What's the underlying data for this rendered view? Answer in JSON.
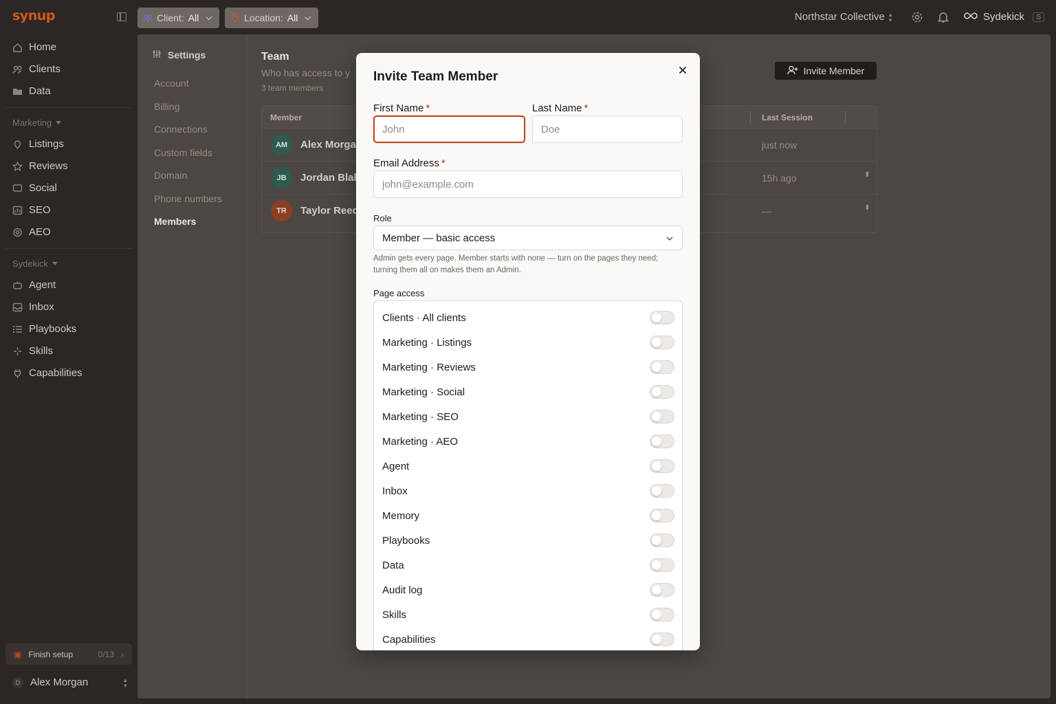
{
  "app": {
    "logo": "synup"
  },
  "topbar": {
    "client_filter": {
      "label": "Client:",
      "value": "All"
    },
    "location_filter": {
      "label": "Location:",
      "value": "All"
    },
    "org_name": "Northstar Collective",
    "sydekick_label": "Sydekick",
    "sydekick_shortcut": "S"
  },
  "sidebar": {
    "top_items": [
      {
        "label": "Home",
        "icon": "home-icon"
      },
      {
        "label": "Clients",
        "icon": "users-icon"
      },
      {
        "label": "Data",
        "icon": "folder-icon"
      }
    ],
    "marketing_label": "Marketing",
    "marketing_items": [
      {
        "label": "Listings",
        "icon": "pin-icon"
      },
      {
        "label": "Reviews",
        "icon": "star-icon"
      },
      {
        "label": "Social",
        "icon": "chat-icon"
      },
      {
        "label": "SEO",
        "icon": "chart-icon"
      },
      {
        "label": "AEO",
        "icon": "target-icon"
      }
    ],
    "sydekick_label": "Sydekick",
    "sydekick_items": [
      {
        "label": "Agent",
        "icon": "bot-icon"
      },
      {
        "label": "Inbox",
        "icon": "inbox-icon"
      },
      {
        "label": "Playbooks",
        "icon": "list-icon"
      },
      {
        "label": "Skills",
        "icon": "sparkle-icon"
      },
      {
        "label": "Capabilities",
        "icon": "plug-icon"
      }
    ],
    "finish_setup": {
      "label": "Finish setup",
      "count": "0/13"
    },
    "user": {
      "initial": "D",
      "name": "Alex Morgan"
    }
  },
  "settings": {
    "heading": "Settings",
    "items": [
      "Account",
      "Billing",
      "Connections",
      "Custom fields",
      "Domain",
      "Phone numbers",
      "Members"
    ],
    "active": "Members"
  },
  "team": {
    "title": "Team",
    "subtitle": "Who has access to y",
    "count": "3 team members",
    "invite_button": "Invite Member",
    "columns": {
      "member": "Member",
      "last_session": "Last Session"
    },
    "rows": [
      {
        "initials": "AM",
        "name": "Alex Morgan",
        "last_session": "just now",
        "avatar_color": "#2e5a4f"
      },
      {
        "initials": "JB",
        "name": "Jordan Blake",
        "last_session": "15h ago",
        "avatar_color": "#2e5a4f"
      },
      {
        "initials": "TR",
        "name": "Taylor Reed",
        "last_session": "—",
        "avatar_color": "#8a3f23"
      }
    ]
  },
  "modal": {
    "title": "Invite Team Member",
    "first_name": {
      "label": "First Name",
      "placeholder": "John",
      "value": ""
    },
    "last_name": {
      "label": "Last Name",
      "placeholder": "Doe",
      "value": ""
    },
    "email": {
      "label": "Email Address",
      "placeholder": "john@example.com",
      "value": ""
    },
    "required_mark": "*",
    "role": {
      "label": "Role",
      "value": "Member — basic access"
    },
    "role_hint": "Admin gets every page. Member starts with none — turn on the pages they need; turning them all on makes them an Admin.",
    "page_access_label": "Page access",
    "pages": [
      {
        "label": "Clients · All clients",
        "enabled": false
      },
      {
        "label": "Marketing · Listings",
        "enabled": false
      },
      {
        "label": "Marketing · Reviews",
        "enabled": false
      },
      {
        "label": "Marketing · Social",
        "enabled": false
      },
      {
        "label": "Marketing · SEO",
        "enabled": false
      },
      {
        "label": "Marketing · AEO",
        "enabled": false
      },
      {
        "label": "Agent",
        "enabled": false
      },
      {
        "label": "Inbox",
        "enabled": false
      },
      {
        "label": "Memory",
        "enabled": false
      },
      {
        "label": "Playbooks",
        "enabled": false
      },
      {
        "label": "Data",
        "enabled": false
      },
      {
        "label": "Audit log",
        "enabled": false
      },
      {
        "label": "Skills",
        "enabled": false
      },
      {
        "label": "Capabilities",
        "enabled": false
      }
    ]
  },
  "colors": {
    "brand": "#d4571f",
    "focus_ring": "#c2461f",
    "required": "#c6321b"
  }
}
